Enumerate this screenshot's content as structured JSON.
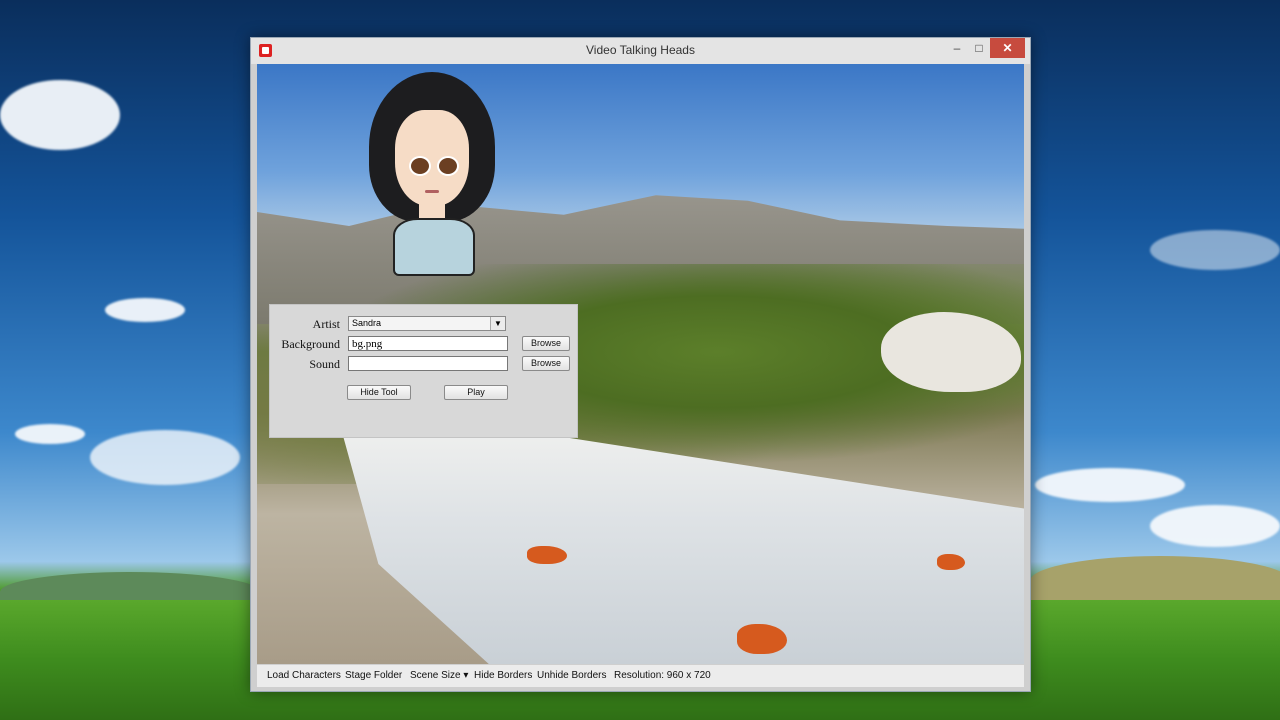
{
  "window": {
    "title": "Video Talking Heads",
    "minimize_glyph": "–",
    "maximize_glyph": "□",
    "close_glyph": "✕"
  },
  "tool_panel": {
    "artist_label": "Artist",
    "artist_selected": "Sandra",
    "background_label": "Background",
    "background_value": "bg.png",
    "sound_label": "Sound",
    "sound_value": "",
    "browse_label": "Browse",
    "hide_tool_label": "Hide Tool",
    "play_label": "Play",
    "dropdown_glyph": "▼"
  },
  "menu_bar": {
    "load_characters": "Load Characters",
    "stage_folder": "Stage Folder",
    "scene_size": "Scene Size",
    "scene_size_glyph": "▾",
    "hide_borders": "Hide Borders",
    "unhide_borders": "Unhide Borders",
    "resolution": "Resolution: 960 x 720"
  },
  "colors": {
    "close_button": "#c74b3e",
    "panel_bg": "#d8d8d8"
  }
}
